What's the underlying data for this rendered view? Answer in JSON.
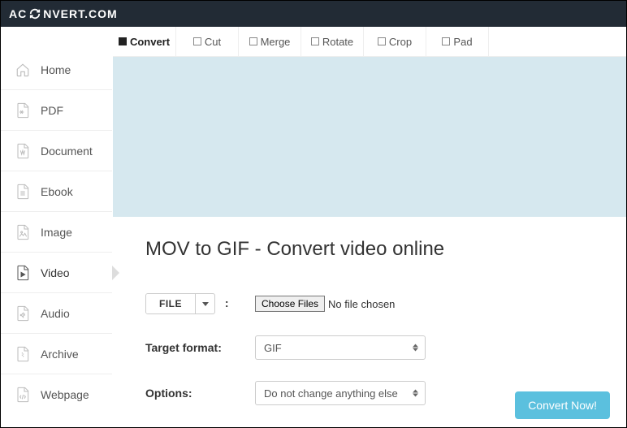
{
  "brand": {
    "prefix": "AC",
    "suffix": "NVERT.COM"
  },
  "sidebar": {
    "items": [
      {
        "label": "Home"
      },
      {
        "label": "PDF"
      },
      {
        "label": "Document"
      },
      {
        "label": "Ebook"
      },
      {
        "label": "Image"
      },
      {
        "label": "Video"
      },
      {
        "label": "Audio"
      },
      {
        "label": "Archive"
      },
      {
        "label": "Webpage"
      }
    ]
  },
  "tabs": [
    {
      "label": "Convert"
    },
    {
      "label": "Cut"
    },
    {
      "label": "Merge"
    },
    {
      "label": "Rotate"
    },
    {
      "label": "Crop"
    },
    {
      "label": "Pad"
    }
  ],
  "page": {
    "title": "MOV to GIF - Convert video online",
    "file_button": "FILE",
    "choose_files": "Choose Files",
    "no_file": "No file chosen",
    "target_format_label": "Target format:",
    "target_format_value": "GIF",
    "options_label": "Options:",
    "options_value": "Do not change anything else",
    "convert_button": "Convert Now!"
  }
}
